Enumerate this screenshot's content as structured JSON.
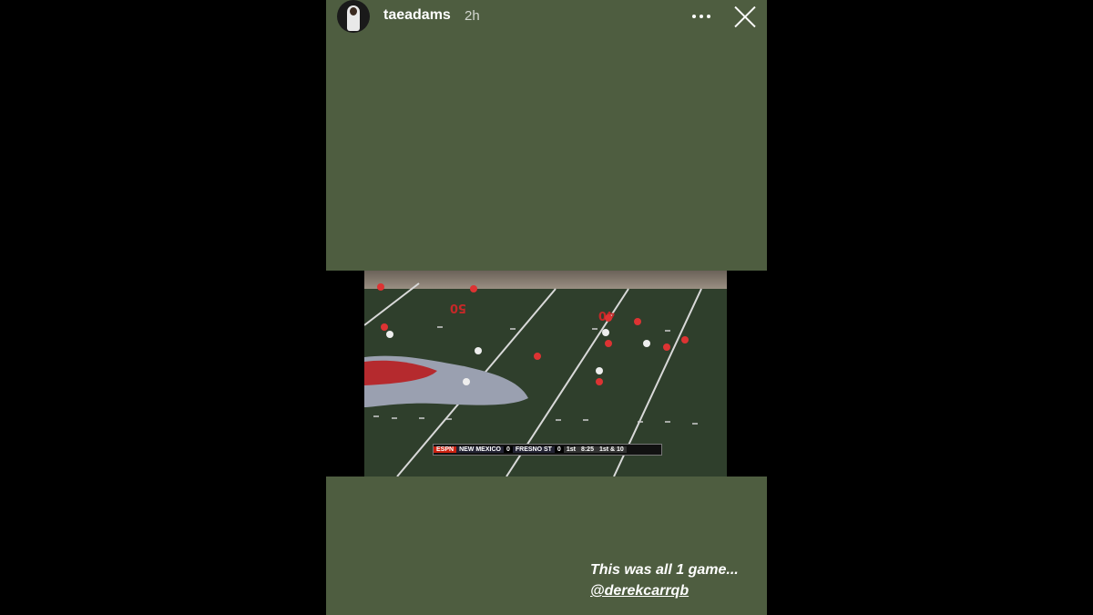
{
  "header": {
    "username": "taeadams",
    "time": "2h"
  },
  "video": {
    "network": "ESPN",
    "team1": "NEW MEXICO",
    "score1": "0",
    "team2": "FRESNO ST",
    "score2": "0",
    "quarter": "1st",
    "clock": "8:25",
    "down": "1st & 10",
    "yard_numbers": [
      "50",
      "40"
    ]
  },
  "caption": {
    "text": "This was all 1 game...",
    "mention": "@derekcarrqb"
  },
  "colors": {
    "story_background": "#4e5d40",
    "field": "#2f3f2c"
  }
}
